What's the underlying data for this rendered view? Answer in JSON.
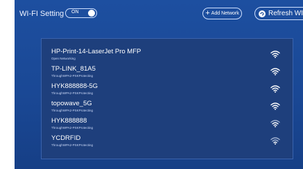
{
  "header": {
    "title": "WI-FI Setting",
    "toggle_label": "ON",
    "add_network_label": "Add Network",
    "refresh_label": "Refresh WI-FI"
  },
  "networks": [
    {
      "ssid": "HP-Print-14-LaserJet Pro MFP",
      "security": "Open Networking",
      "signal": "strong"
    },
    {
      "ssid": "TP-LINK_81A5",
      "security": "ThroughWPA2-PSKProtecting",
      "signal": "strong"
    },
    {
      "ssid": "HYK888888-5G",
      "security": "ThroughWPA2-PSKProtecting",
      "signal": "strong"
    },
    {
      "ssid": "topowave_5G",
      "security": "ThroughWPA2-PSKProtecting",
      "signal": "strong"
    },
    {
      "ssid": "HYK888888",
      "security": "ThroughWPA2-PSKProtecting",
      "signal": "medium"
    },
    {
      "ssid": "YCDRFID",
      "security": "ThroughWPA2-PSKProtecting",
      "signal": "weak"
    }
  ],
  "colors": {
    "background": "#1a4895",
    "panel": "#1e3f7c",
    "signal_strong": "#ffffff",
    "signal_weak": "#9fb0cf"
  }
}
